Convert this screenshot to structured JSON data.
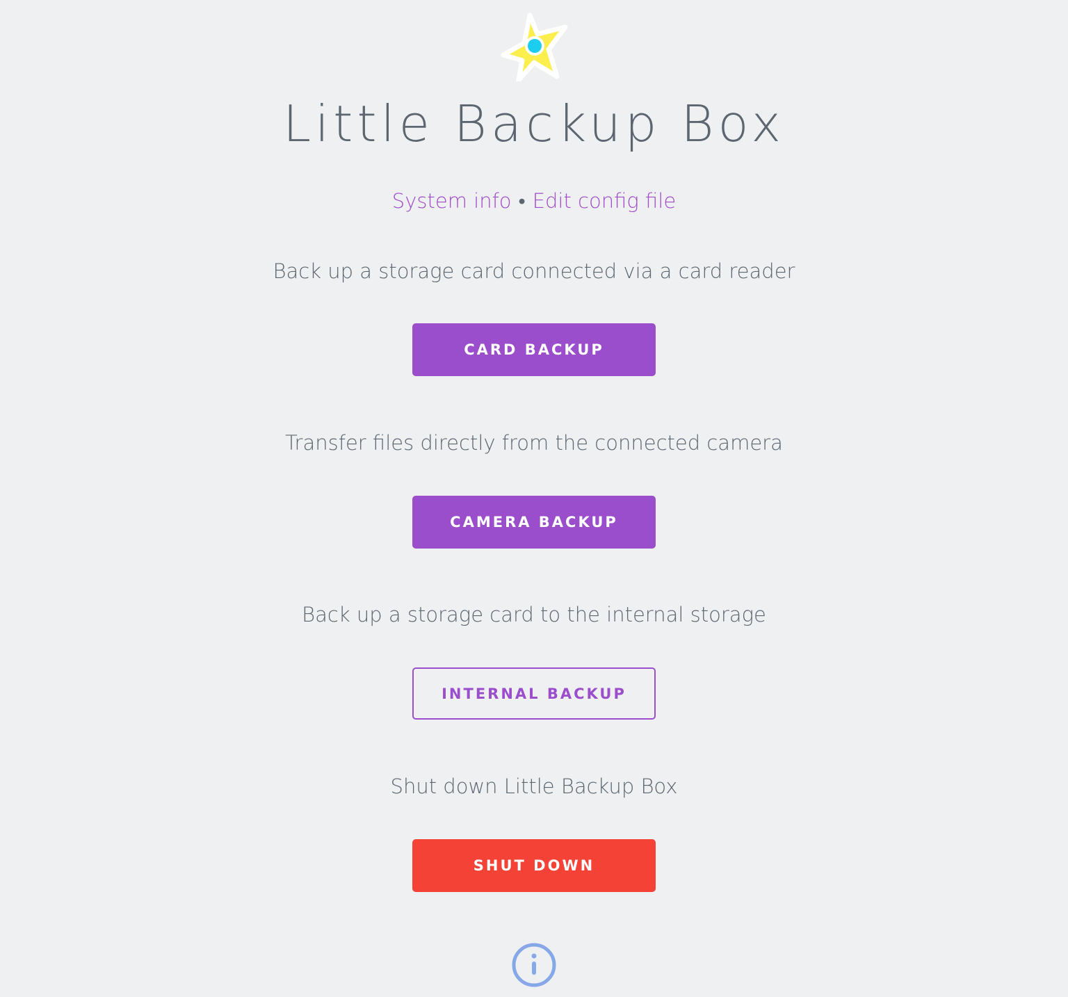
{
  "app": {
    "title": "Little Backup Box",
    "logo_icon": "star-logo-icon"
  },
  "nav": {
    "system_info": "System info",
    "separator": "•",
    "edit_config": "Edit config file"
  },
  "sections": [
    {
      "description": "Back up a storage card connected via a card reader",
      "button": "CARD BACKUP",
      "style": "primary"
    },
    {
      "description": "Transfer files directly from the connected camera",
      "button": "CAMERA BACKUP",
      "style": "primary"
    },
    {
      "description": "Back up a storage card to the internal storage",
      "button": "INTERNAL BACKUP",
      "style": "outline"
    },
    {
      "description": "Shut down Little Backup Box",
      "button": "SHUT DOWN",
      "style": "danger"
    }
  ],
  "footer": {
    "icon": "info-icon"
  },
  "colors": {
    "background": "#eff0f2",
    "accent": "#9b4ecc",
    "link": "#a04bcc",
    "danger": "#f44336",
    "text": "#5c6670",
    "info": "#86a8e7",
    "star": "#fbee4d",
    "star_dot": "#1ccdf0"
  }
}
